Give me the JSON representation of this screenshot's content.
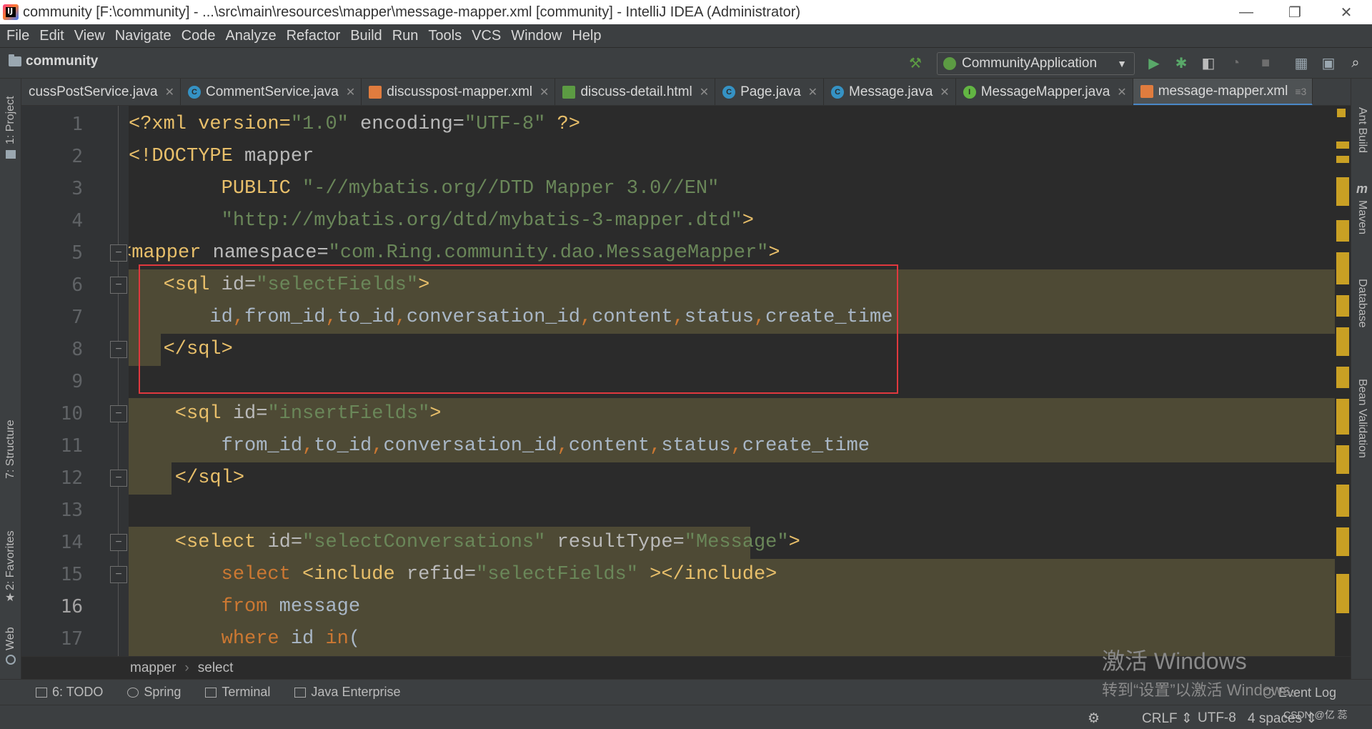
{
  "window": {
    "title": "community [F:\\community] - ...\\src\\main\\resources\\mapper\\message-mapper.xml [community] - IntelliJ IDEA (Administrator)",
    "minimize": "—",
    "restore": "❐",
    "close": "✕"
  },
  "menu": [
    "File",
    "Edit",
    "View",
    "Navigate",
    "Code",
    "Analyze",
    "Refactor",
    "Build",
    "Run",
    "Tools",
    "VCS",
    "Window",
    "Help"
  ],
  "navbar": {
    "project": "community",
    "run_config": "CommunityApplication"
  },
  "tabs": [
    {
      "label": "cussPostService.java",
      "icon": "class-icon",
      "color": "#3592c4",
      "letter": ""
    },
    {
      "label": "CommentService.java",
      "icon": "class-icon",
      "color": "#3592c4",
      "letter": "C"
    },
    {
      "label": "discusspost-mapper.xml",
      "icon": "xml-icon",
      "color": "#e07c3e",
      "letter": ""
    },
    {
      "label": "discuss-detail.html",
      "icon": "html-icon",
      "color": "#5c9b43",
      "letter": ""
    },
    {
      "label": "Page.java",
      "icon": "class-icon",
      "color": "#3592c4",
      "letter": "C"
    },
    {
      "label": "Message.java",
      "icon": "class-icon",
      "color": "#3592c4",
      "letter": "C"
    },
    {
      "label": "MessageMapper.java",
      "icon": "interface-icon",
      "color": "#62b543",
      "letter": "I"
    },
    {
      "label": "message-mapper.xml",
      "icon": "xml-icon",
      "color": "#e07c3e",
      "letter": "",
      "active": true
    }
  ],
  "tab_overflow": "≡3",
  "left_tools": [
    "1: Project",
    "7: Structure",
    "2: Favorites",
    "Web"
  ],
  "right_tools": [
    "Ant Build",
    "Maven",
    "Database",
    "Bean Validation"
  ],
  "line_numbers": [
    "1",
    "2",
    "3",
    "4",
    "5",
    "6",
    "7",
    "8",
    "9",
    "10",
    "11",
    "12",
    "13",
    "14",
    "15",
    "16",
    "17"
  ],
  "code": {
    "l1": {
      "a": "<?xml version=",
      "b": "\"1.0\"",
      "c": " encoding=",
      "d": "\"UTF-8\"",
      "e": " ?>"
    },
    "l2": {
      "a": "<!DOCTYPE ",
      "b": "mapper"
    },
    "l3": {
      "a": "        PUBLIC ",
      "b": "\"-//mybatis.org//DTD Mapper 3.0//EN\""
    },
    "l4": {
      "a": "        ",
      "b": "\"http://mybatis.org/dtd/mybatis-3-mapper.dtd\"",
      "c": ">"
    },
    "l5": {
      "a": "<mapper ",
      "b": "namespace=",
      "c": "\"com.Ring.community.dao.MessageMapper\"",
      "d": ">"
    },
    "l6": {
      "a": "   <sql ",
      "b": "id=",
      "c": "\"selectFields\"",
      "d": ">"
    },
    "l7": {
      "t": [
        "id",
        "from_id",
        "to_id",
        "conversation_id",
        "content",
        "status",
        "create_time"
      ],
      "indent": "       "
    },
    "l8": {
      "a": "   </sql>"
    },
    "l10": {
      "a": "    <sql ",
      "b": "id=",
      "c": "\"insertFields\"",
      "d": ">"
    },
    "l11": {
      "t": [
        "from_id",
        "to_id",
        "conversation_id",
        "content",
        "status",
        "create_time"
      ],
      "indent": "        "
    },
    "l12": {
      "a": "    </sql>"
    },
    "l14": {
      "a": "    <select ",
      "b": "id=",
      "c": "\"selectConversations\"",
      "d": " resultType=",
      "e": "\"Message\"",
      "f": ">"
    },
    "l15": {
      "a": "        ",
      "b": "select ",
      "c": "<include ",
      "d": "refid=",
      "e": "\"selectFields\"",
      "f": " ></include>"
    },
    "l16": {
      "a": "        ",
      "b": "from ",
      "c": "message"
    },
    "l17": {
      "a": "        ",
      "b": "where ",
      "c": "id ",
      "d": "in",
      "e": "("
    }
  },
  "breadcrumb": [
    "mapper",
    "select"
  ],
  "bottom_tools": [
    {
      "label": "6: TODO",
      "icon": "todo-icon"
    },
    {
      "label": "Spring",
      "icon": "spring-icon"
    },
    {
      "label": "Terminal",
      "icon": "terminal-icon"
    },
    {
      "label": "Java Enterprise",
      "icon": "java-enterprise-icon"
    }
  ],
  "event_log": "Event Log",
  "status": {
    "line_sep": "CRLF ⇕",
    "encoding": "UTF-8",
    "indent": "4 spaces ⇕"
  },
  "watermark": {
    "line1": "激活 Windows",
    "line2": "转到“设置”以激活 Windows。"
  },
  "csdn": "CSDN @亿 蕊"
}
